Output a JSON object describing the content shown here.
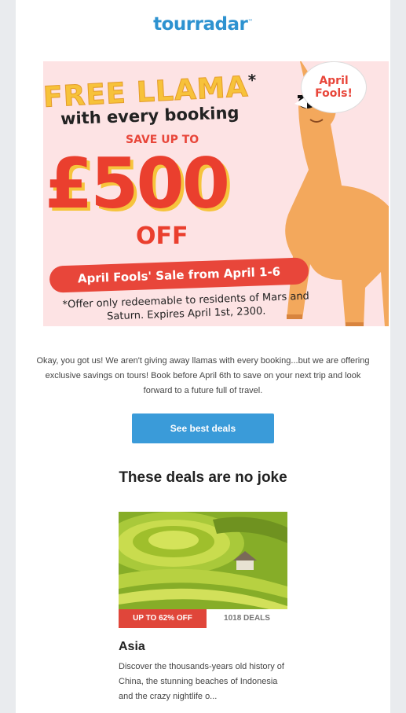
{
  "brand": {
    "logo_text": "tourradar",
    "logo_mark": "™",
    "accent": "#2d92d0"
  },
  "hero": {
    "title": "FREE LLAMA",
    "title_star": "*",
    "subtitle": "with every booking",
    "save_label": "SAVE UP TO",
    "amount": "£500",
    "off": "OFF",
    "sale_pill": "April Fools' Sale from April 1-6",
    "fine_print": "*Offer only redeemable to residents of Mars and Saturn. Expires April 1st, 2300.",
    "bubble": "April Fools!",
    "bg_color": "#fde3e4",
    "red": "#e8463a",
    "yellow": "#f7c23a"
  },
  "intro_text": "Okay, you got us! We aren't giving away llamas with every booking...but we are offering exclusive savings on tours! Book before April 6th to save on your next trip and look forward to a future full of travel.",
  "cta_label": "See best deals",
  "section_title": "These deals are no joke",
  "deal_card": {
    "badge": "UP TO 62% OFF",
    "deals_count": "1018 DEALS",
    "title": "Asia",
    "description": "Discover the thousands-years old history of China, the stunning beaches of Indonesia and the crazy nightlife o..."
  }
}
